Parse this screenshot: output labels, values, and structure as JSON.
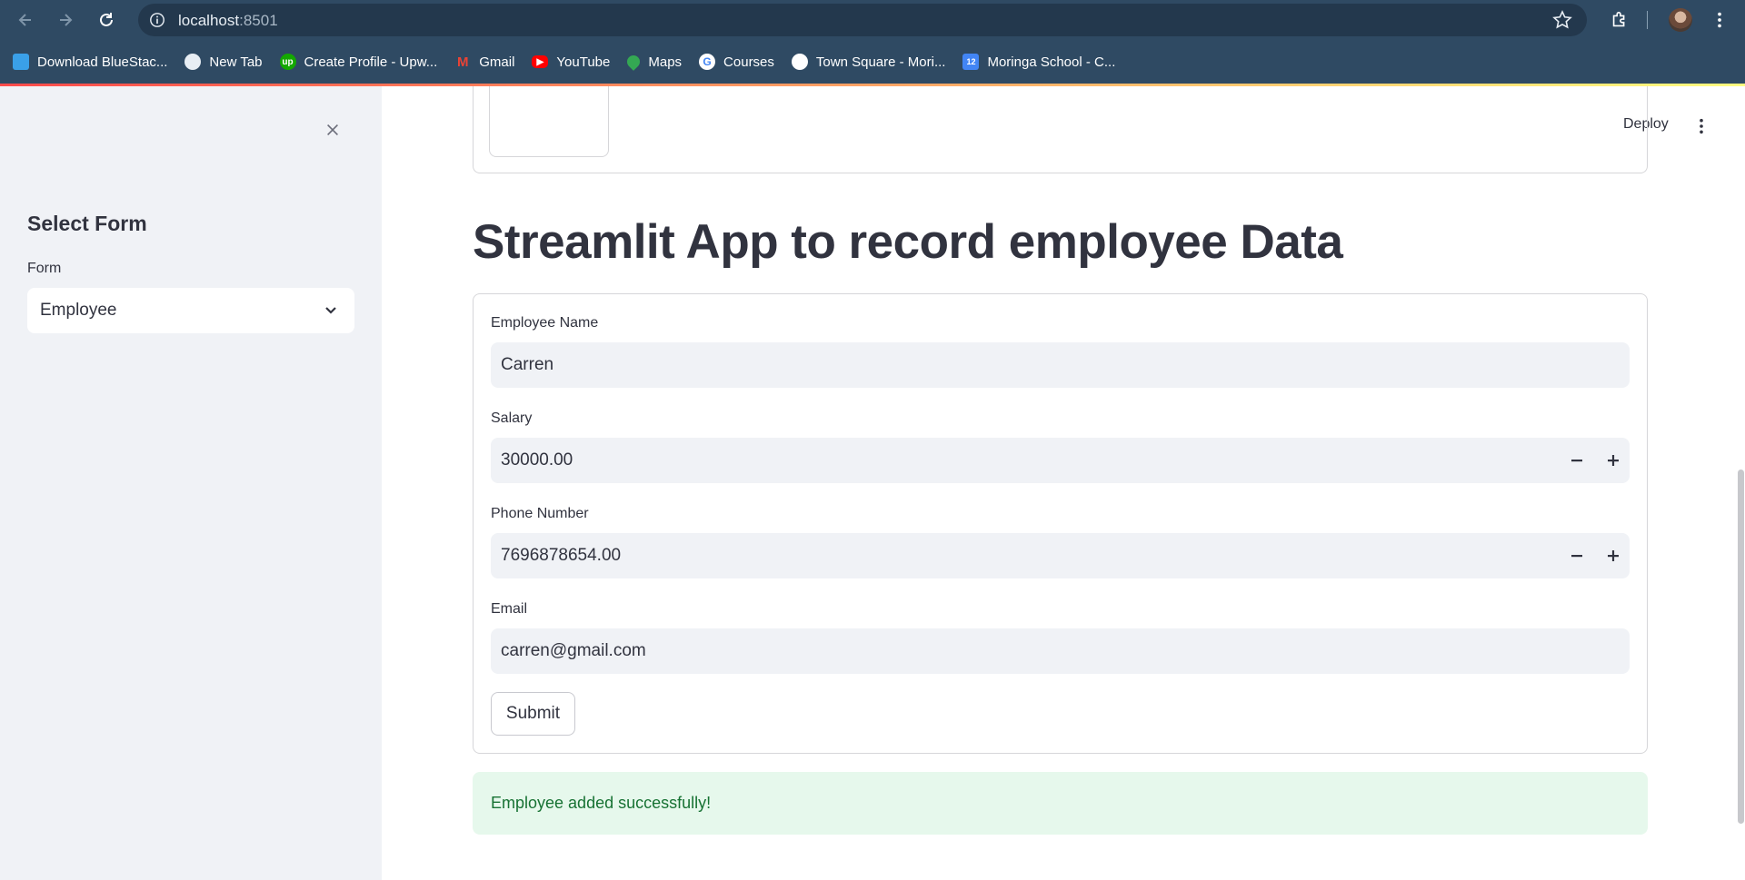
{
  "browser": {
    "url_host": "localhost",
    "url_port": ":8501",
    "bookmarks": [
      {
        "label": "Download BlueStac...",
        "icon": "bluestacks-icon",
        "color": "#3aa0e8"
      },
      {
        "label": "New Tab",
        "icon": "globe-icon",
        "color": "#ffffff"
      },
      {
        "label": "Create Profile - Upw...",
        "icon": "upwork-icon",
        "color": "#14a800"
      },
      {
        "label": "Gmail",
        "icon": "gmail-icon",
        "color": "#ea4335"
      },
      {
        "label": "YouTube",
        "icon": "youtube-icon",
        "color": "#ff0000"
      },
      {
        "label": "Maps",
        "icon": "maps-icon",
        "color": "#34a853"
      },
      {
        "label": "Courses",
        "icon": "google-icon",
        "color": "#ffffff"
      },
      {
        "label": "Town Square - Mori...",
        "icon": "town-square-icon",
        "color": "#ffffff"
      },
      {
        "label": "Moringa School - C...",
        "icon": "calendar-icon",
        "color": "#4285f4"
      }
    ]
  },
  "sidebar": {
    "title": "Select Form",
    "select_label": "Form",
    "selected": "Employee"
  },
  "header": {
    "deploy_label": "Deploy"
  },
  "main": {
    "title": "Streamlit App to record employee Data",
    "form": {
      "name_label": "Employee Name",
      "name_value": "Carren",
      "salary_label": "Salary",
      "salary_value": "30000.00",
      "phone_label": "Phone Number",
      "phone_value": "7696878654.00",
      "email_label": "Email",
      "email_value": "carren@gmail.com",
      "submit_label": "Submit"
    },
    "success_message": "Employee added successfully!"
  },
  "colors": {
    "chrome": "#2f4a63",
    "sidebar_bg": "#f0f2f6",
    "success_bg": "#e6f8ec",
    "success_text": "#177233"
  }
}
